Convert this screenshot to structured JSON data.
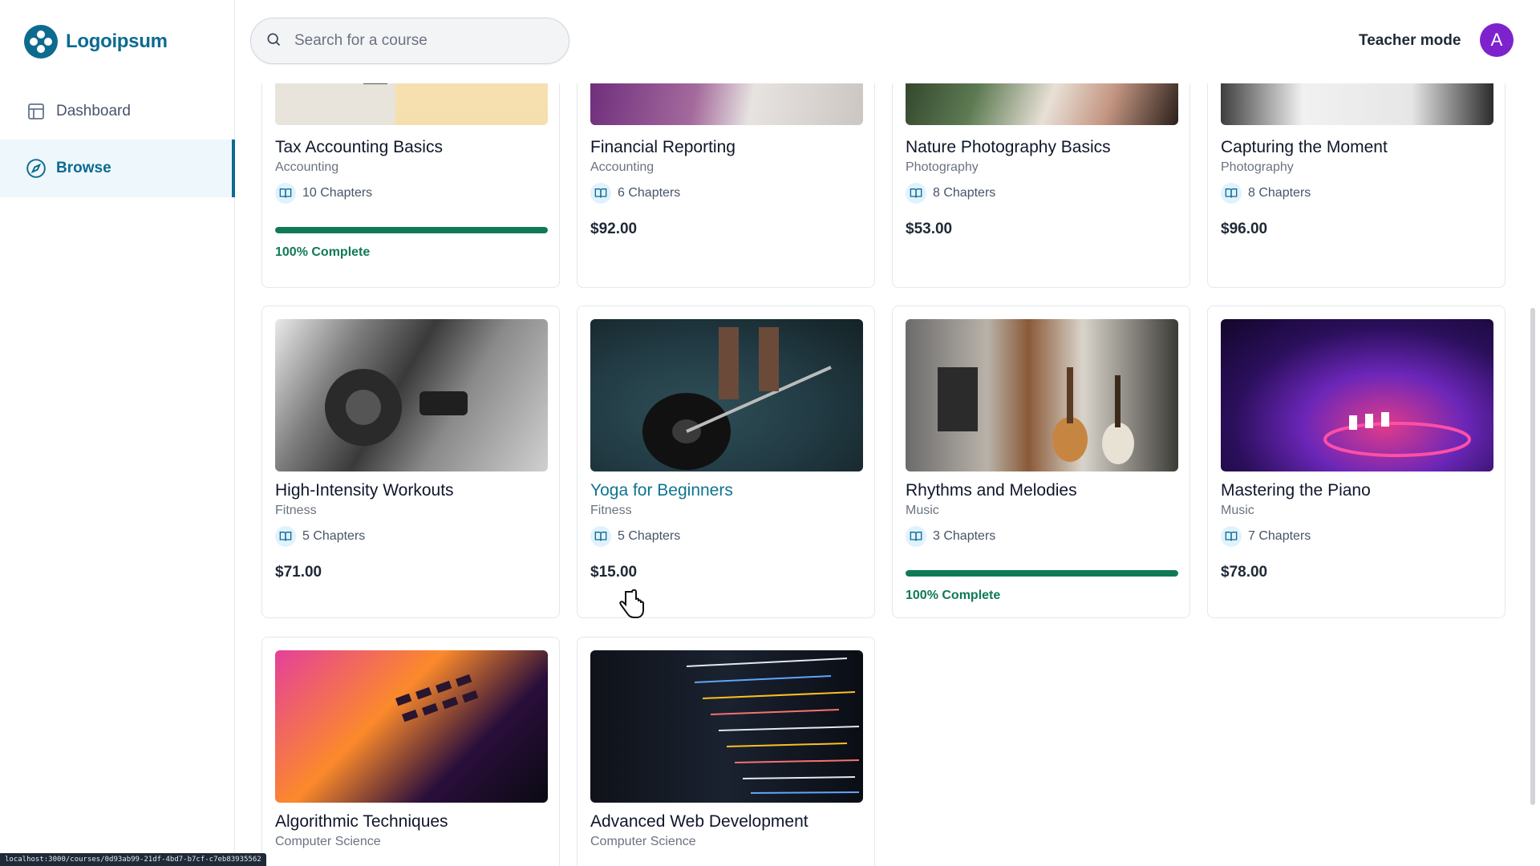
{
  "brand": {
    "name": "Logoipsum"
  },
  "sidebar": {
    "items": [
      {
        "label": "Dashboard",
        "icon": "layout-icon"
      },
      {
        "label": "Browse",
        "icon": "compass-icon"
      }
    ]
  },
  "search": {
    "placeholder": "Search for a course"
  },
  "header": {
    "teacher_mode_label": "Teacher mode",
    "avatar_initial": "A"
  },
  "colors": {
    "accent": "#0c6b8f",
    "progress": "#0f7a55",
    "avatar": "#7e22ce"
  },
  "courses": [
    {
      "title": "Tax Accounting Basics",
      "category": "Accounting",
      "chapters": "10 Chapters",
      "progress_label": "100% Complete",
      "progress": 1.0
    },
    {
      "title": "Financial Reporting",
      "category": "Accounting",
      "chapters": "6 Chapters",
      "price": "$92.00"
    },
    {
      "title": "Nature Photography Basics",
      "category": "Photography",
      "chapters": "8 Chapters",
      "price": "$53.00"
    },
    {
      "title": "Capturing the Moment",
      "category": "Photography",
      "chapters": "8 Chapters",
      "price": "$96.00"
    },
    {
      "title": "High-Intensity Workouts",
      "category": "Fitness",
      "chapters": "5 Chapters",
      "price": "$71.00"
    },
    {
      "title": "Yoga for Beginners",
      "category": "Fitness",
      "chapters": "5 Chapters",
      "price": "$15.00"
    },
    {
      "title": "Rhythms and Melodies",
      "category": "Music",
      "chapters": "3 Chapters",
      "progress_label": "100% Complete",
      "progress": 1.0
    },
    {
      "title": "Mastering the Piano",
      "category": "Music",
      "chapters": "7 Chapters",
      "price": "$78.00"
    },
    {
      "title": "Algorithmic Techniques",
      "category": "Computer Science"
    },
    {
      "title": "Advanced Web Development",
      "category": "Computer Science"
    }
  ],
  "status_url": "localhost:3000/courses/0d93ab99-21df-4bd7-b7cf-c7eb83935562"
}
